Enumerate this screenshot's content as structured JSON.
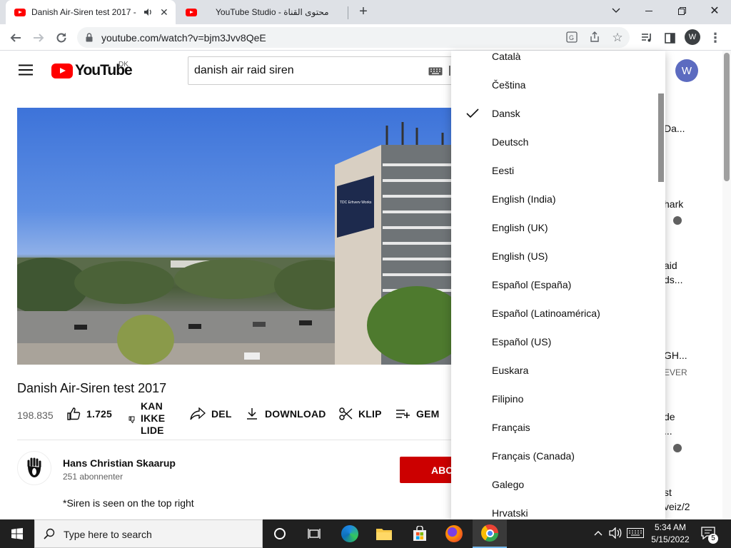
{
  "tabs": [
    {
      "title": "Danish Air-Siren test 2017 -",
      "active": true
    },
    {
      "title": "YouTube Studio - محتوى القناة",
      "active": false
    }
  ],
  "address_bar": {
    "url": "youtube.com/watch?v=bjm3Jvv8QeE"
  },
  "profile_initial": "W",
  "youtube": {
    "logo_text": "YouTube",
    "region": "DK",
    "search_value": "danish air raid siren",
    "avatar_initial": "W"
  },
  "video": {
    "title": "Danish Air-Siren test 2017",
    "views": "198.835",
    "likes": "1.725",
    "dislike_label": "KAN IKKE LIDE",
    "dislike_lines": [
      "KAN",
      "IKKE",
      "LIDE"
    ],
    "share_label": "DEL",
    "download_label": "DOWNLOAD",
    "clip_label": "KLIP",
    "save_label": "GEM",
    "billboard_title": "TDC Erhverv Works"
  },
  "channel": {
    "name": "Hans Christian Skaarup",
    "subscribers": "251 abonnenter",
    "subscribe_label": "ABONNE",
    "description": "*Siren is seen on the top right"
  },
  "language_menu": {
    "selected": "Dansk",
    "items": [
      "Català",
      "Čeština",
      "Dansk",
      "Deutsch",
      "Eesti",
      "English (India)",
      "English (UK)",
      "English (US)",
      "Español (España)",
      "Español (Latinoamérica)",
      "Español (US)",
      "Euskara",
      "Filipino",
      "Français",
      "Français (Canada)",
      "Galego",
      "Hrvatski"
    ]
  },
  "right_column_peek": [
    "Da...",
    "hark",
    "aid",
    "ds...",
    "GH...",
    "EVER",
    "de",
    "...",
    "st",
    "veiz/2"
  ],
  "taskbar": {
    "search_placeholder": "Type here to search",
    "time": "5:34 AM",
    "date": "5/15/2022",
    "notification_count": "5"
  },
  "colors": {
    "youtube_red": "#ff0000",
    "subscribe_red": "#cc0000",
    "avatar": "#5c6bc0",
    "taskbar": "#202020"
  },
  "icons": [
    "hamburger-menu-icon",
    "back-icon",
    "forward-icon",
    "reload-icon",
    "lock-icon",
    "translate-icon",
    "share-icon",
    "star-icon",
    "media-icon",
    "sidepanel-icon",
    "kebab-icon",
    "keyboard-icon",
    "like-icon",
    "dislike-icon",
    "share-arrow-icon",
    "download-icon",
    "scissors-icon",
    "add-list-icon",
    "check-icon",
    "windows-icon",
    "search-icon",
    "cortana-icon",
    "task-view-icon",
    "edge-icon",
    "explorer-icon",
    "store-icon",
    "firefox-icon",
    "chrome-icon",
    "chevron-up-icon",
    "volume-icon",
    "keyboard-tray-icon",
    "notification-icon"
  ]
}
